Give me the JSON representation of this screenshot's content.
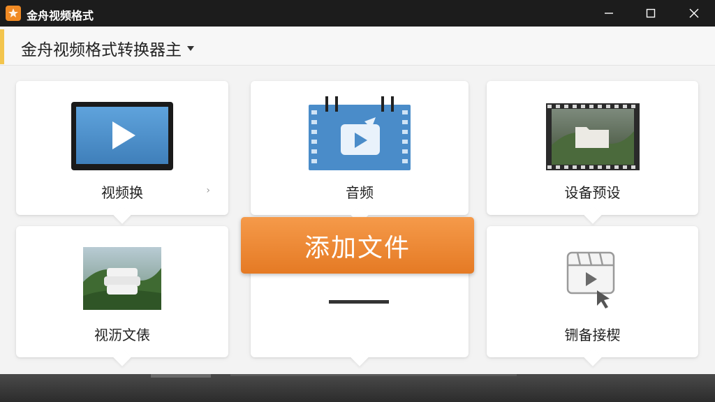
{
  "titlebar": {
    "title": "金舟视频格式"
  },
  "header": {
    "title": "金舟视频格式转换器主"
  },
  "cards": [
    {
      "label": "视频换",
      "icon": "monitor-play-icon"
    },
    {
      "label": "音频",
      "icon": "film-strip-video-icon"
    },
    {
      "label": "设备预设",
      "icon": "landscape-folder-icon"
    },
    {
      "label": "视沥文俵",
      "icon": "landscape-layers-icon"
    },
    {
      "label": "",
      "icon": ""
    },
    {
      "label": "铏备接楔",
      "icon": "film-clip-cursor-icon"
    }
  ],
  "add_button": {
    "label": "添加文件"
  },
  "colors": {
    "accent": "#ef8a32",
    "header_accent": "#f3c54d",
    "card_blue": "#4a8cc9"
  }
}
